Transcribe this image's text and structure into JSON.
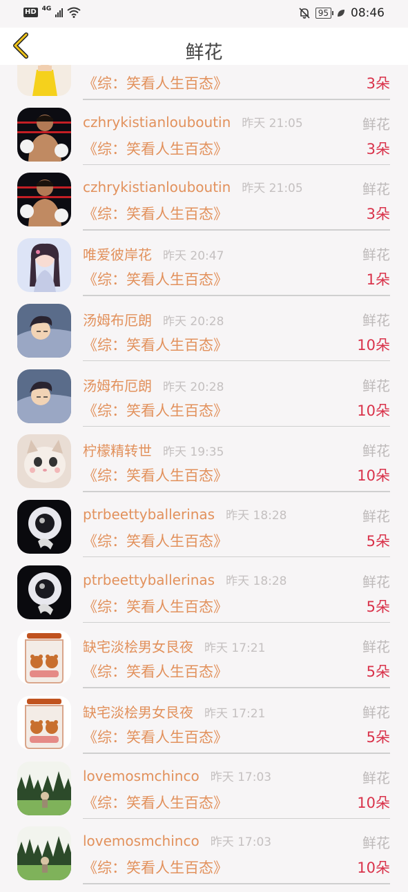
{
  "status_bar": {
    "hd": "HD",
    "network": "4G",
    "battery": "95",
    "time": "08:46"
  },
  "header": {
    "title": "鲜花",
    "back_icon": "chevron-left-icon",
    "accent_color": "#f0c419"
  },
  "colors": {
    "name": "#e2915c",
    "count": "#d9324a",
    "muted": "#c4c0c0",
    "divider": "#cfcfcf"
  },
  "rows": [
    {
      "name": "",
      "time": "",
      "label": "",
      "book": "《综：笑看人生百态》",
      "count": "3朵",
      "avatar": "girl-yellow-dress"
    },
    {
      "name": "czhrykistianlouboutin",
      "time": "昨天 21:05",
      "label": "鲜花",
      "book": "《综：笑看人生百态》",
      "count": "3朵",
      "avatar": "boxer"
    },
    {
      "name": "czhrykistianlouboutin",
      "time": "昨天 21:05",
      "label": "鲜花",
      "book": "《综：笑看人生百态》",
      "count": "3朵",
      "avatar": "boxer"
    },
    {
      "name": "唯爱彼岸花",
      "time": "昨天 20:47",
      "label": "鲜花",
      "book": "《综：笑看人生百态》",
      "count": "1朵",
      "avatar": "anime-girl"
    },
    {
      "name": "汤姆布厄朗",
      "time": "昨天 20:28",
      "label": "鲜花",
      "book": "《综：笑看人生百态》",
      "count": "10朵",
      "avatar": "sleeping-boy"
    },
    {
      "name": "汤姆布厄朗",
      "time": "昨天 20:28",
      "label": "鲜花",
      "book": "《综：笑看人生百态》",
      "count": "10朵",
      "avatar": "sleeping-boy"
    },
    {
      "name": "柠檬精转世",
      "time": "昨天 19:35",
      "label": "鲜花",
      "book": "《综：笑看人生百态》",
      "count": "10朵",
      "avatar": "cat"
    },
    {
      "name": "ptrbeettyballerinas",
      "time": "昨天 18:28",
      "label": "鲜花",
      "book": "《综：笑看人生百态》",
      "count": "5朵",
      "avatar": "fluffy-white"
    },
    {
      "name": "ptrbeettyballerinas",
      "time": "昨天 18:28",
      "label": "鲜花",
      "book": "《综：笑看人生百态》",
      "count": "5朵",
      "avatar": "fluffy-white"
    },
    {
      "name": "缺宅淡桧男女艮夜",
      "time": "昨天 17:21",
      "label": "鲜花",
      "book": "《综：笑看人生百态》",
      "count": "5朵",
      "avatar": "bears-in-jar"
    },
    {
      "name": "缺宅淡桧男女艮夜",
      "time": "昨天 17:21",
      "label": "鲜花",
      "book": "《综：笑看人生百态》",
      "count": "5朵",
      "avatar": "bears-in-jar"
    },
    {
      "name": "lovemosmchinco",
      "time": "昨天 17:03",
      "label": "鲜花",
      "book": "《综：笑看人生百态》",
      "count": "10朵",
      "avatar": "forest"
    },
    {
      "name": "lovemosmchinco",
      "time": "昨天 17:03",
      "label": "鲜花",
      "book": "《综：笑看人生百态》",
      "count": "10朵",
      "avatar": "forest"
    }
  ]
}
